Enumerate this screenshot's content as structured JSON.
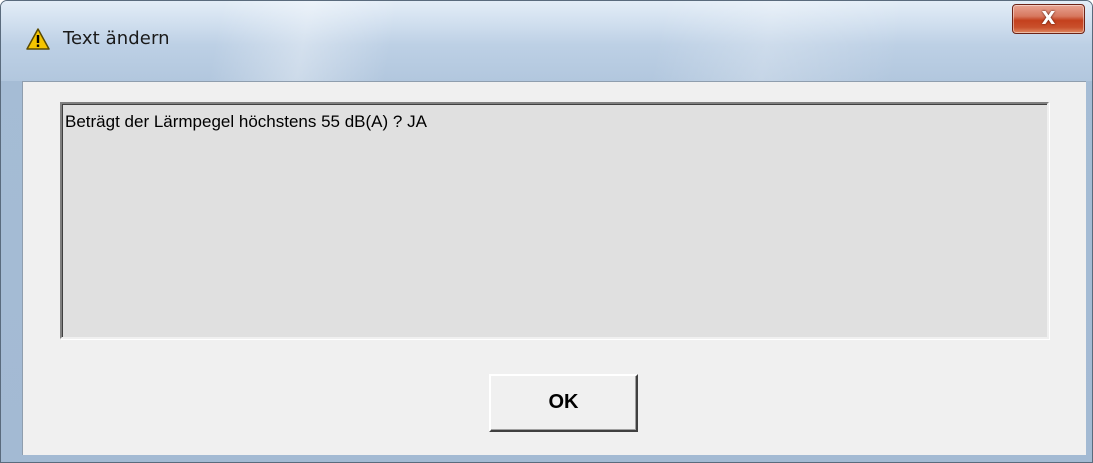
{
  "window": {
    "title": "Text ändern",
    "title_icon": "warning-icon",
    "close_label": "X"
  },
  "message": {
    "text": "Beträgt der Lärmpegel höchstens 55 dB(A) ? JA"
  },
  "buttons": {
    "ok_label": "OK"
  },
  "colors": {
    "warning_fill": "#f5c400",
    "close_button": "#c4401d",
    "dialog_background": "#f0f0f0",
    "textbox_background": "#e0e0e0"
  }
}
